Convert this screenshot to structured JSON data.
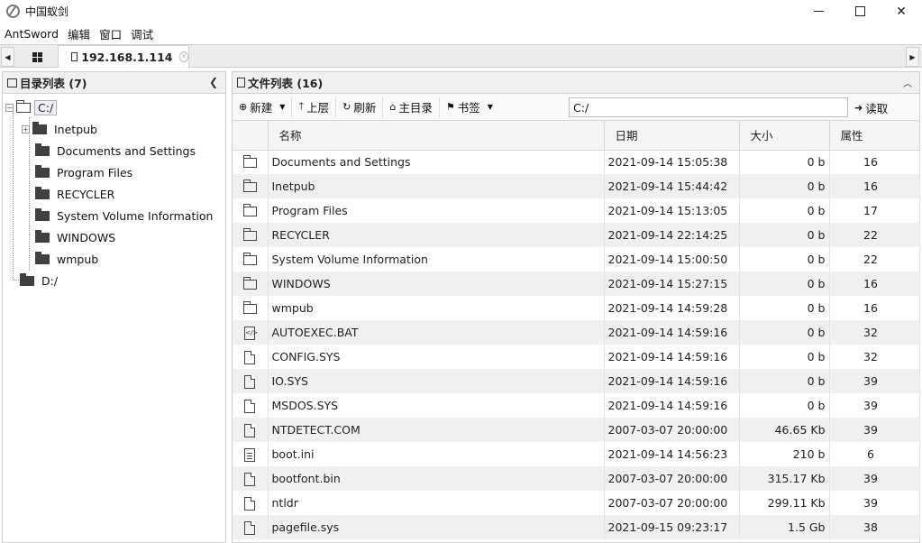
{
  "window": {
    "title": "中国蚁剑"
  },
  "menu": [
    "AntSword",
    "编辑",
    "窗口",
    "调试"
  ],
  "tab": {
    "label": "192.168.1.114"
  },
  "left_panel": {
    "title": "目录列表 (7)",
    "root_items": [
      "C:/",
      "D:/"
    ],
    "children": [
      "Inetpub",
      "Documents and Settings",
      "Program Files",
      "RECYCLER",
      "System Volume Information",
      "WINDOWS",
      "wmpub"
    ]
  },
  "right_panel": {
    "title": "文件列表 (16)",
    "toolbar": {
      "new_label": "新建",
      "up_label": "上层",
      "refresh_label": "刷新",
      "home_label": "主目录",
      "bookmark_label": "书签",
      "path_value": "C:/",
      "read_label": "读取"
    },
    "columns": [
      "名称",
      "日期",
      "大小",
      "属性"
    ],
    "rows": [
      {
        "icon": "folder-icon",
        "name": "Documents and Settings",
        "date": "2021-09-14 15:05:38",
        "size": "0 b",
        "attr": "16"
      },
      {
        "icon": "folder-icon",
        "name": "Inetpub",
        "date": "2021-09-14 15:44:42",
        "size": "0 b",
        "attr": "16"
      },
      {
        "icon": "folder-icon",
        "name": "Program Files",
        "date": "2021-09-14 15:13:05",
        "size": "0 b",
        "attr": "17"
      },
      {
        "icon": "folder-icon",
        "name": "RECYCLER",
        "date": "2021-09-14 22:14:25",
        "size": "0 b",
        "attr": "22"
      },
      {
        "icon": "folder-icon",
        "name": "System Volume Information",
        "date": "2021-09-14 15:00:50",
        "size": "0 b",
        "attr": "22"
      },
      {
        "icon": "folder-icon",
        "name": "WINDOWS",
        "date": "2021-09-14 15:27:15",
        "size": "0 b",
        "attr": "16"
      },
      {
        "icon": "folder-icon",
        "name": "wmpub",
        "date": "2021-09-14 14:59:28",
        "size": "0 b",
        "attr": "16"
      },
      {
        "icon": "code-file-icon",
        "name": "AUTOEXEC.BAT",
        "date": "2021-09-14 14:59:16",
        "size": "0 b",
        "attr": "32"
      },
      {
        "icon": "file-icon",
        "name": "CONFIG.SYS",
        "date": "2021-09-14 14:59:16",
        "size": "0 b",
        "attr": "32"
      },
      {
        "icon": "file-icon",
        "name": "IO.SYS",
        "date": "2021-09-14 14:59:16",
        "size": "0 b",
        "attr": "39"
      },
      {
        "icon": "file-icon",
        "name": "MSDOS.SYS",
        "date": "2021-09-14 14:59:16",
        "size": "0 b",
        "attr": "39"
      },
      {
        "icon": "file-icon",
        "name": "NTDETECT.COM",
        "date": "2007-03-07 20:00:00",
        "size": "46.65 Kb",
        "attr": "39"
      },
      {
        "icon": "text-file-icon",
        "name": "boot.ini",
        "date": "2021-09-14 14:56:23",
        "size": "210 b",
        "attr": "6"
      },
      {
        "icon": "file-icon",
        "name": "bootfont.bin",
        "date": "2007-03-07 20:00:00",
        "size": "315.17 Kb",
        "attr": "39"
      },
      {
        "icon": "file-icon",
        "name": "ntldr",
        "date": "2007-03-07 20:00:00",
        "size": "299.11 Kb",
        "attr": "39"
      },
      {
        "icon": "file-icon",
        "name": "pagefile.sys",
        "date": "2021-09-15 09:23:17",
        "size": "1.5 Gb",
        "attr": "38"
      }
    ]
  }
}
